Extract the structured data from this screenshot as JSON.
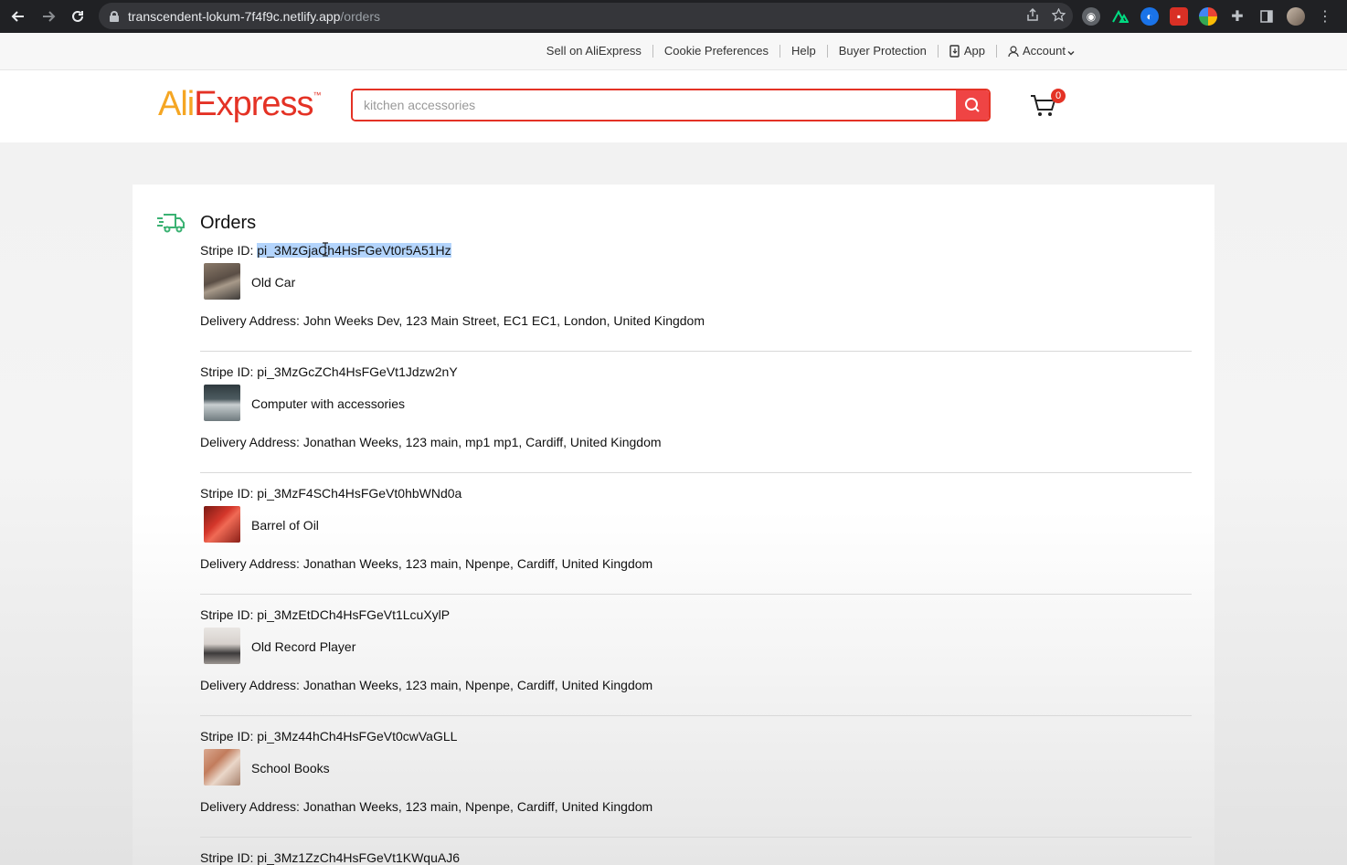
{
  "browser": {
    "url_host": "transcendent-lokum-7f4f9c.netlify.app",
    "url_path": "/orders"
  },
  "topbar": {
    "links": [
      "Sell on AliExpress",
      "Cookie Preferences",
      "Help",
      "Buyer Protection"
    ],
    "app_label": "App",
    "account_label": "Account"
  },
  "header": {
    "logo_ali": "Ali",
    "logo_express": "Express",
    "logo_tm": "™",
    "search_placeholder": "kitchen accessories",
    "cart_count": "0"
  },
  "orders": {
    "title": "Orders",
    "stripe_prefix": "Stripe ID: ",
    "address_prefix": "Delivery Address: ",
    "items": [
      {
        "stripe_id": "pi_3MzGjaCh4HsFGeVt0r5A51Hz",
        "product": "Old Car",
        "address": "John Weeks Dev, 123 Main Street, EC1 EC1, London, United Kingdom"
      },
      {
        "stripe_id": "pi_3MzGcZCh4HsFGeVt1Jdzw2nY",
        "product": "Computer with accessories",
        "address": "Jonathan Weeks, 123 main, mp1 mp1, Cardiff, United Kingdom"
      },
      {
        "stripe_id": "pi_3MzF4SCh4HsFGeVt0hbWNd0a",
        "product": "Barrel of Oil",
        "address": "Jonathan Weeks, 123 main, Npenpe, Cardiff, United Kingdom"
      },
      {
        "stripe_id": "pi_3MzEtDCh4HsFGeVt1LcuXylP",
        "product": "Old Record Player",
        "address": "Jonathan Weeks, 123 main, Npenpe, Cardiff, United Kingdom"
      },
      {
        "stripe_id": "pi_3Mz44hCh4HsFGeVt0cwVaGLL",
        "product": "School Books",
        "address": "Jonathan Weeks, 123 main, Npenpe, Cardiff, United Kingdom"
      },
      {
        "stripe_id": "pi_3Mz1ZzCh4HsFGeVt1KWquAJ6"
      }
    ]
  }
}
